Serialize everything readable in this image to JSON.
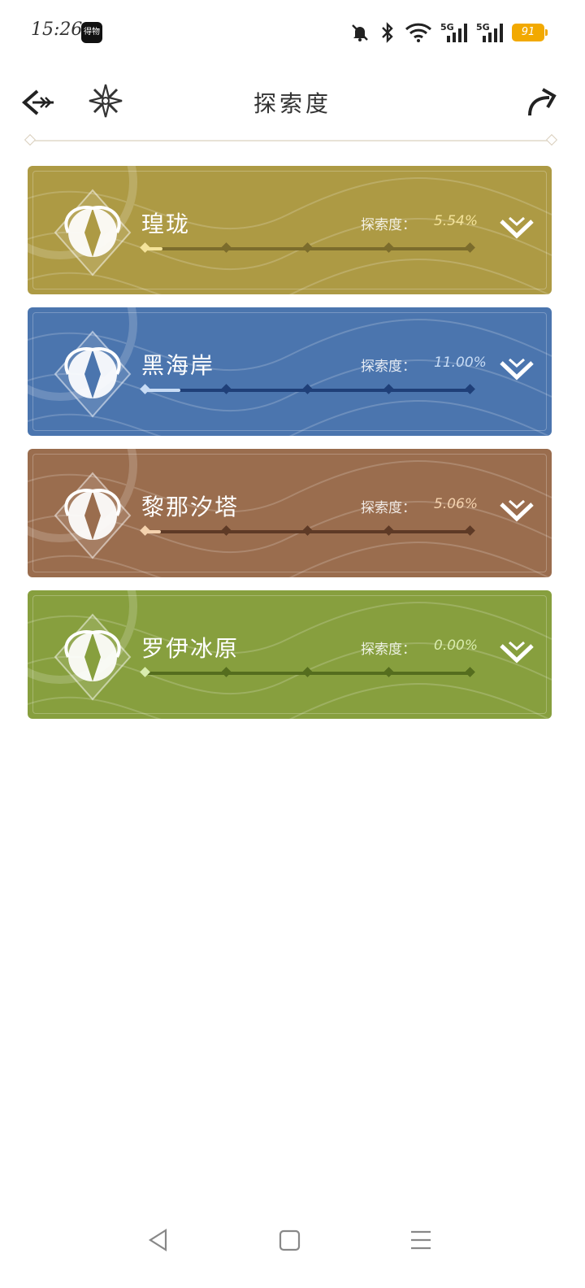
{
  "status_bar": {
    "time": "15:26",
    "app_badge": "得物",
    "battery": "91"
  },
  "header": {
    "title": "探索度"
  },
  "regions": [
    {
      "name": "瑝珑",
      "progress_label": "探索度：",
      "progress_value": "5.54%",
      "progress": 0.0554,
      "color": "#ad9a44",
      "fill_color": "#f4e39a",
      "track_color": "#7b6c2c",
      "value_color": "#f4e39a"
    },
    {
      "name": "黑海岸",
      "progress_label": "探索度：",
      "progress_value": "11.00%",
      "progress": 0.11,
      "color": "#4b75ae",
      "fill_color": "#c8dcf5",
      "track_color": "#1f3f78",
      "value_color": "#c8dcf5"
    },
    {
      "name": "黎那汐塔",
      "progress_label": "探索度：",
      "progress_value": "5.06%",
      "progress": 0.0506,
      "color": "#9a6d4e",
      "fill_color": "#f4d2ae",
      "track_color": "#5e3a26",
      "value_color": "#f4d2ae"
    },
    {
      "name": "罗伊冰原",
      "progress_label": "探索度：",
      "progress_value": "0.00%",
      "progress": 0.0,
      "color": "#879f3e",
      "fill_color": "#d9ecae",
      "track_color": "#556d1e",
      "value_color": "#d9ecae"
    }
  ],
  "icons": {
    "back": "back-arrow-icon",
    "compass": "compass-icon",
    "share": "share-arrow-icon",
    "expand": "chevron-down-icon"
  }
}
